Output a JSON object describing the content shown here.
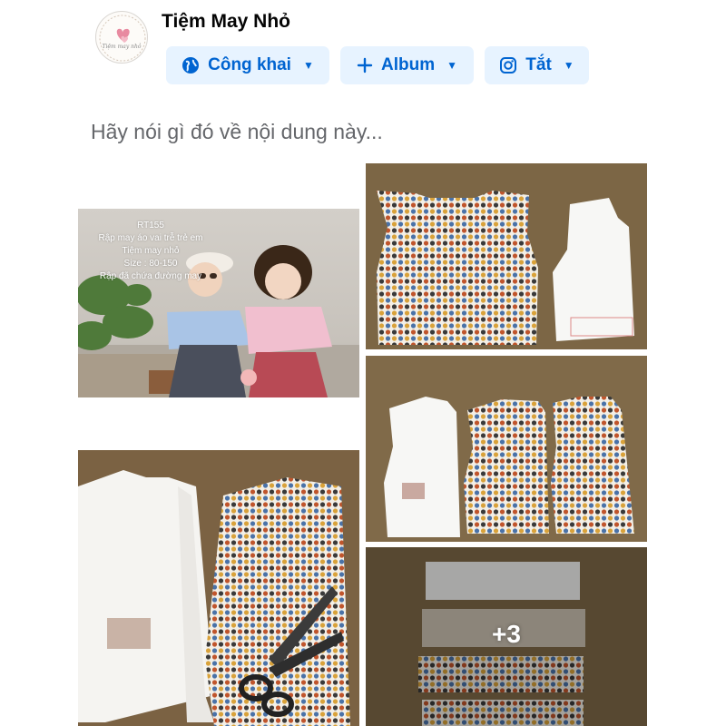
{
  "page": {
    "name": "Tiệm May Nhỏ",
    "avatar_brand": "Tiệm may nhỏ"
  },
  "audience_chips": [
    {
      "label": "Công khai",
      "icon": "globe-icon"
    },
    {
      "label": "Album",
      "icon": "plus-icon"
    },
    {
      "label": "Tắt",
      "icon": "instagram-icon"
    }
  ],
  "composer": {
    "placeholder": "Hãy nói gì đó về nội dung này..."
  },
  "photos": {
    "cover_overlay": [
      "RT155",
      "Rập may áo vai trễ trẻ em",
      "Tiệm may nhỏ",
      "Size : 80-150",
      "Rập đã chứa đường may"
    ],
    "more_count": "+3"
  },
  "colors": {
    "accent": "#0064d1",
    "chip_bg": "#e7f3ff",
    "placeholder": "#65676b"
  }
}
